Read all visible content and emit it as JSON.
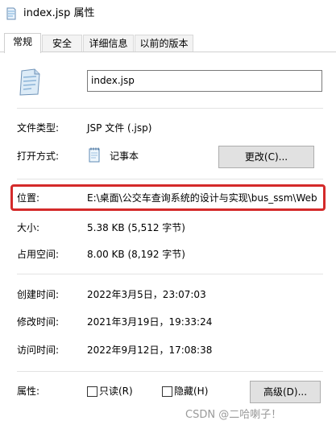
{
  "window": {
    "title": "index.jsp 属性"
  },
  "tabs": [
    {
      "label": "常规",
      "active": true
    },
    {
      "label": "安全",
      "active": false
    },
    {
      "label": "详细信息",
      "active": false
    },
    {
      "label": "以前的版本",
      "active": false
    }
  ],
  "general": {
    "file_name": "index.jsp",
    "file_type_label": "文件类型:",
    "file_type_value": "JSP 文件 (.jsp)",
    "open_with_label": "打开方式:",
    "open_with_value": "记事本",
    "change_button": "更改(C)...",
    "location_label": "位置:",
    "location_value": "E:\\桌面\\公交车查询系统的设计与实现\\bus_ssm\\Web",
    "size_label": "大小:",
    "size_value": "5.38 KB (5,512 字节)",
    "size_on_disk_label": "占用空间:",
    "size_on_disk_value": "8.00 KB (8,192 字节)",
    "created_label": "创建时间:",
    "created_value": "2022年3月5日，23:07:03",
    "modified_label": "修改时间:",
    "modified_value": "2021年3月19日，19:33:24",
    "accessed_label": "访问时间:",
    "accessed_value": "2022年9月12日，17:08:38",
    "attributes_label": "属性:",
    "readonly_label": "只读(R)",
    "hidden_label": "隐藏(H)",
    "advanced_button": "高级(D)..."
  },
  "watermark": "CSDN @二哈喇子！",
  "colors": {
    "highlight": "#d42a2a",
    "button_bg": "#e1e1e1"
  },
  "icons": {
    "title": "jsp-file-icon",
    "file": "jsp-file-icon",
    "open_with": "notepad-icon"
  }
}
